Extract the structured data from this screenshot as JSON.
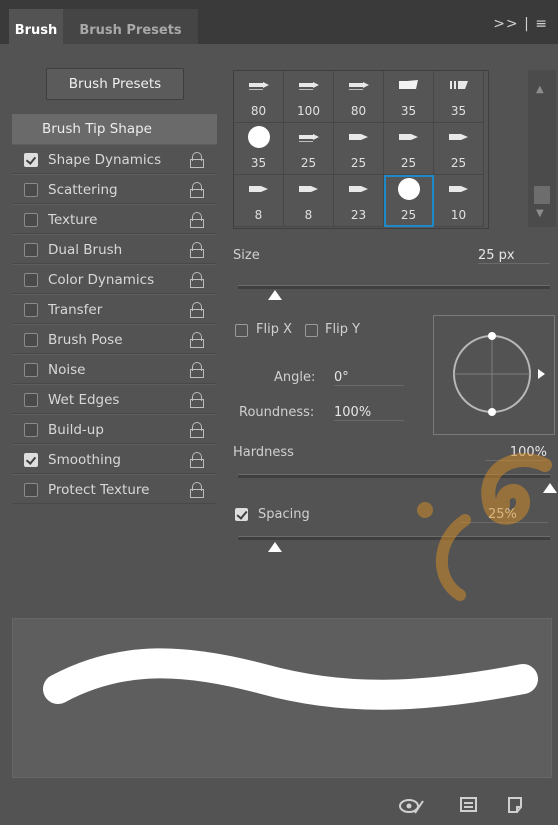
{
  "tabs": {
    "active": "Brush",
    "inactive": "Brush Presets"
  },
  "header_menu": ">> | ≡",
  "brush_presets_button": "Brush Presets",
  "options": [
    {
      "label": "Brush Tip Shape",
      "checked": null,
      "lock": false
    },
    {
      "label": "Shape Dynamics",
      "checked": true,
      "lock": true
    },
    {
      "label": "Scattering",
      "checked": false,
      "lock": true
    },
    {
      "label": "Texture",
      "checked": false,
      "lock": true
    },
    {
      "label": "Dual Brush",
      "checked": false,
      "lock": true
    },
    {
      "label": "Color Dynamics",
      "checked": false,
      "lock": true
    },
    {
      "label": "Transfer",
      "checked": false,
      "lock": true
    },
    {
      "label": "Brush Pose",
      "checked": false,
      "lock": true
    },
    {
      "label": "Noise",
      "checked": false,
      "lock": true
    },
    {
      "label": "Wet Edges",
      "checked": false,
      "lock": true
    },
    {
      "label": "Build-up",
      "checked": false,
      "lock": true
    },
    {
      "label": "Smoothing",
      "checked": true,
      "lock": true
    },
    {
      "label": "Protect Texture",
      "checked": false,
      "lock": true
    }
  ],
  "presets": {
    "sizes": [
      "80",
      "100",
      "80",
      "35",
      "35",
      "35",
      "25",
      "25",
      "25",
      "25",
      "8",
      "8",
      "23",
      "25",
      "10"
    ],
    "icons": [
      "tip",
      "tip",
      "tip",
      "flat",
      "fan",
      "round",
      "tip",
      "arrow",
      "arrow",
      "arrow",
      "arrow",
      "arrow",
      "arrow",
      "round",
      "arrow"
    ],
    "selected_index": 13
  },
  "size": {
    "label": "Size",
    "value": "25 px",
    "slider_fraction": 0.12
  },
  "flip_x": {
    "label": "Flip X",
    "checked": false
  },
  "flip_y": {
    "label": "Flip Y",
    "checked": false
  },
  "angle": {
    "label": "Angle:",
    "value": "0°"
  },
  "roundness": {
    "label": "Roundness:",
    "value": "100%"
  },
  "hardness": {
    "label": "Hardness",
    "value": "100%",
    "slider_fraction": 1.0
  },
  "spacing": {
    "label": "Spacing",
    "value": "25%",
    "checked": true,
    "slider_fraction": 0.12
  },
  "colors": {
    "panel": "#535353",
    "selection": "#1e88c8",
    "watermark": "#d08a2a"
  }
}
